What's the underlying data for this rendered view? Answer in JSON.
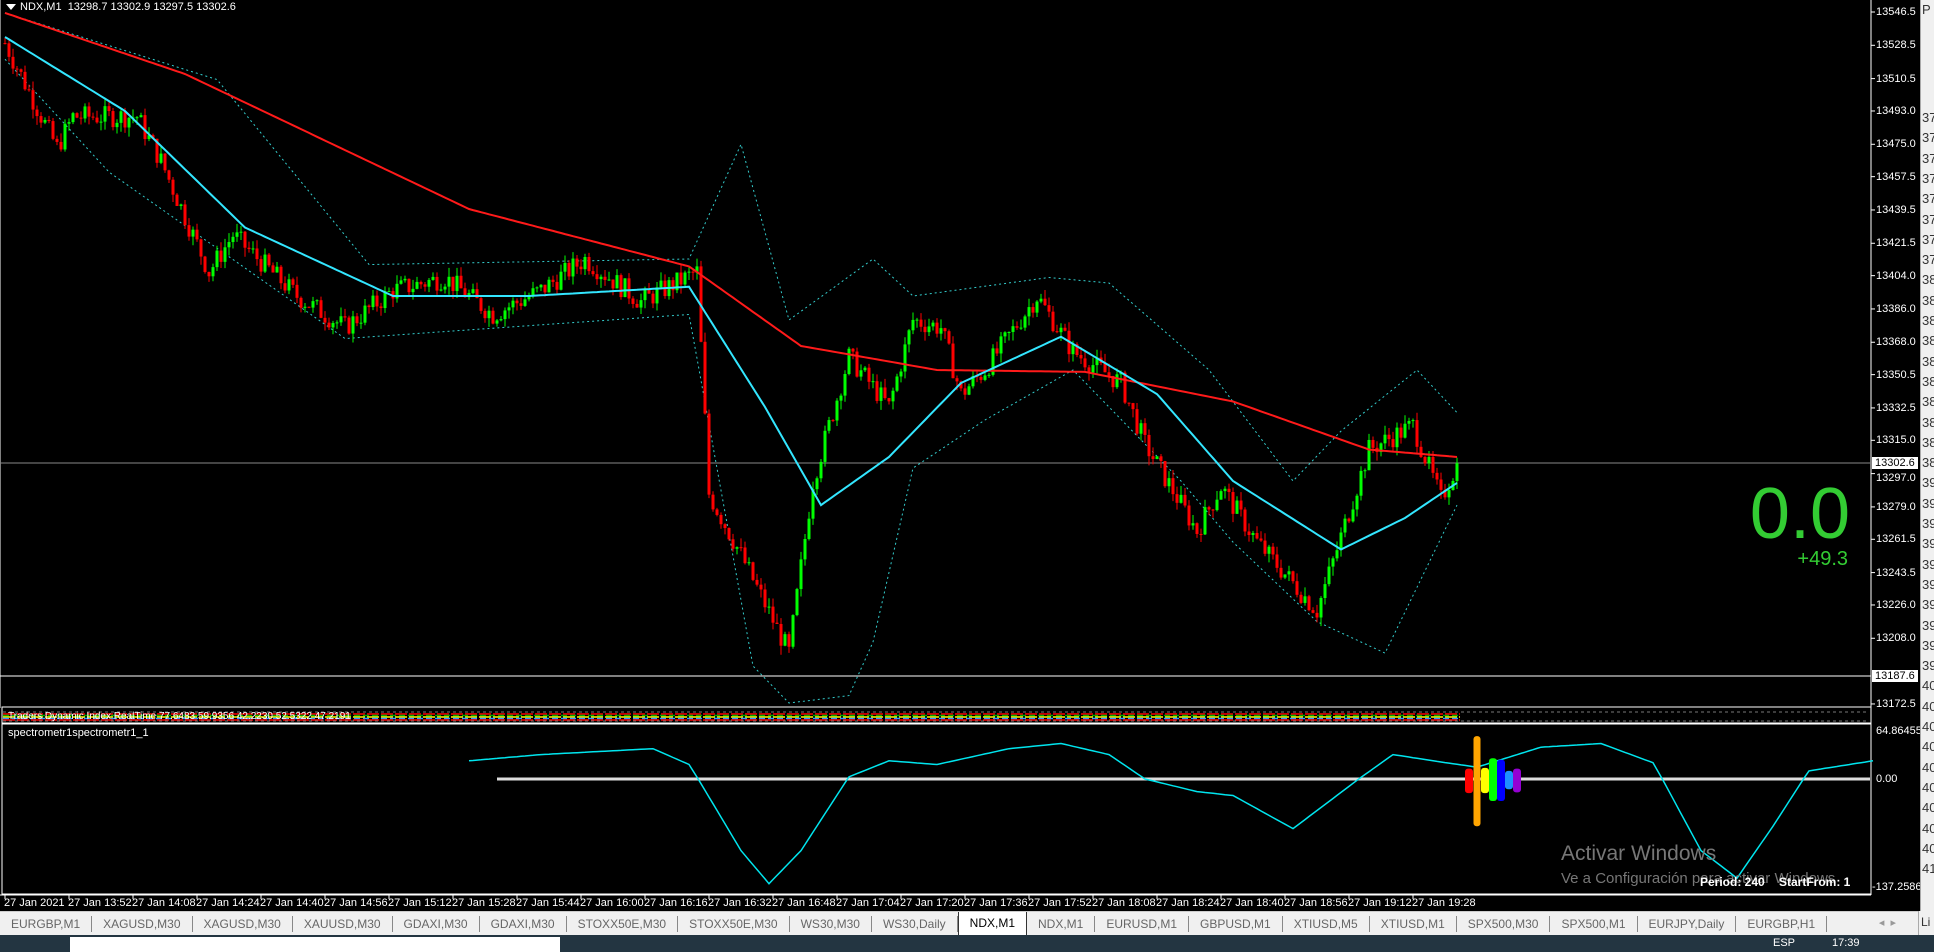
{
  "header": {
    "symbol": "NDX,M1",
    "ohlc": "13298.7 13302.9 13297.5 13302.6"
  },
  "price_axis": {
    "labels": [
      "13546.5",
      "13528.5",
      "13510.5",
      "13493.0",
      "13475.0",
      "13457.5",
      "13439.5",
      "13421.5",
      "13404.0",
      "13386.0",
      "13368.0",
      "13350.5",
      "13332.5",
      "13315.0",
      "13297.0",
      "13279.0",
      "13261.5",
      "13243.5",
      "13226.0",
      "13208.0",
      "13172.5"
    ],
    "current": "13302.6",
    "line2": "13187.6"
  },
  "time_axis": {
    "labels": [
      "27 Jan 2021",
      "27 Jan 13:52",
      "27 Jan 14:08",
      "27 Jan 14:24",
      "27 Jan 14:40",
      "27 Jan 14:56",
      "27 Jan 15:12",
      "27 Jan 15:28",
      "27 Jan 15:44",
      "27 Jan 16:00",
      "27 Jan 16:16",
      "27 Jan 16:32",
      "27 Jan 16:48",
      "27 Jan 17:04",
      "27 Jan 17:20",
      "27 Jan 17:36",
      "27 Jan 17:52",
      "27 Jan 18:08",
      "27 Jan 18:24",
      "27 Jan 18:40",
      "27 Jan 18:56",
      "27 Jan 19:12",
      "27 Jan 19:28"
    ]
  },
  "tdi": {
    "label": "Traders Dynamic Index RealTime 77.6483 59.9356 42.2230 52.5322 47.2191"
  },
  "spectrometer": {
    "label": "spectrometr1spectrometr1_1",
    "max": "64.86455",
    "zero": "0.00",
    "min": "-137.2586",
    "period": "Period: 240",
    "start_from": "StartFrom: 1"
  },
  "display": {
    "big": "0.0",
    "change": "+49.3"
  },
  "watermark": {
    "title": "Activar Windows",
    "sub": "Ve a Configuración para activar Windows"
  },
  "tabs": [
    "EURGBP,M1",
    "XAGUSD,M30",
    "XAGUSD,M30",
    "XAUUSD,M30",
    "GDAXI,M30",
    "GDAXI,M30",
    "STOXX50E,M30",
    "STOXX50E,M30",
    "WS30,M30",
    "WS30,Daily",
    "NDX,M1",
    "NDX,M1",
    "EURUSD,M1",
    "GBPUSD,M1",
    "XTIUSD,M5",
    "XTIUSD,M1",
    "SPX500,M30",
    "SPX500,M1",
    "EURJPY,Daily",
    "EURGBP,H1"
  ],
  "active_tab": 10,
  "tab_extra": "Li",
  "taskbar": {
    "lang": "ESP",
    "time": "17:39"
  },
  "right_panel": {
    "top": "P",
    "rows": [
      "37",
      "37",
      "37",
      "37",
      "37",
      "37",
      "37",
      "37",
      "38",
      "38",
      "38",
      "38",
      "38",
      "38",
      "38",
      "38",
      "38",
      "38",
      "39",
      "39",
      "39",
      "39",
      "39",
      "39",
      "39",
      "39",
      "39",
      "39",
      "40",
      "40",
      "40",
      "40",
      "40",
      "40",
      "40",
      "40",
      "40",
      "41"
    ]
  },
  "colors": {
    "bull": "#00ff00",
    "bear": "#ff0000",
    "ma_slow": "#ff1a1a",
    "ma_fast": "#33e6ff",
    "bands": "#33cccc",
    "big": "#33cc33"
  },
  "chart_data": {
    "type": "candlestick",
    "x_unit": "minutes since 13:36",
    "close_path": [
      [
        0,
        13529.7
      ],
      [
        13,
        13473
      ],
      [
        17,
        13490
      ],
      [
        33,
        13490
      ],
      [
        39,
        13466
      ],
      [
        51,
        13406
      ],
      [
        57,
        13426
      ],
      [
        73,
        13393
      ],
      [
        85,
        13376
      ],
      [
        97,
        13396
      ],
      [
        110,
        13403
      ],
      [
        122,
        13383
      ],
      [
        134,
        13396
      ],
      [
        145,
        13413
      ],
      [
        159,
        13390
      ],
      [
        173,
        13406
      ],
      [
        176,
        13286
      ],
      [
        184,
        13253
      ],
      [
        196,
        13200
      ],
      [
        202,
        13293
      ],
      [
        211,
        13360
      ],
      [
        221,
        13333
      ],
      [
        227,
        13380
      ],
      [
        234,
        13376
      ],
      [
        239,
        13340
      ],
      [
        245,
        13353
      ],
      [
        258,
        13393
      ],
      [
        267,
        13363
      ],
      [
        279,
        13346
      ],
      [
        285,
        13313
      ],
      [
        298,
        13266
      ],
      [
        304,
        13290
      ],
      [
        313,
        13260
      ],
      [
        328,
        13223
      ],
      [
        333,
        13256
      ],
      [
        341,
        13310
      ],
      [
        352,
        13323
      ],
      [
        359,
        13283
      ],
      [
        363,
        13302.6
      ]
    ],
    "ma_slow": [
      [
        0,
        13546
      ],
      [
        45,
        13513
      ],
      [
        116,
        13440
      ],
      [
        171,
        13409
      ],
      [
        199,
        13366
      ],
      [
        233,
        13353
      ],
      [
        270,
        13352
      ],
      [
        307,
        13336
      ],
      [
        341,
        13310
      ],
      [
        363,
        13306
      ]
    ],
    "ma_fast": [
      [
        0,
        13533
      ],
      [
        30,
        13493
      ],
      [
        60,
        13430
      ],
      [
        97,
        13393
      ],
      [
        131,
        13393
      ],
      [
        171,
        13398
      ],
      [
        190,
        13333
      ],
      [
        204,
        13280
      ],
      [
        221,
        13306
      ],
      [
        239,
        13346
      ],
      [
        264,
        13371
      ],
      [
        288,
        13340
      ],
      [
        307,
        13293
      ],
      [
        334,
        13256
      ],
      [
        350,
        13273
      ],
      [
        363,
        13292
      ]
    ],
    "band_upper": [
      [
        0,
        13546
      ],
      [
        53,
        13510
      ],
      [
        91,
        13410
      ],
      [
        171,
        13413
      ],
      [
        184,
        13475
      ],
      [
        196,
        13380
      ],
      [
        217,
        13413
      ],
      [
        227,
        13393
      ],
      [
        261,
        13403
      ],
      [
        276,
        13400
      ],
      [
        301,
        13353
      ],
      [
        322,
        13293
      ],
      [
        334,
        13320
      ],
      [
        353,
        13353
      ],
      [
        363,
        13330
      ]
    ],
    "band_lower": [
      [
        0,
        13521
      ],
      [
        26,
        13460
      ],
      [
        85,
        13370
      ],
      [
        171,
        13383
      ],
      [
        187,
        13193
      ],
      [
        196,
        13173
      ],
      [
        211,
        13177
      ],
      [
        217,
        13206
      ],
      [
        227,
        13300
      ],
      [
        245,
        13326
      ],
      [
        267,
        13353
      ],
      [
        294,
        13293
      ],
      [
        307,
        13260
      ],
      [
        328,
        13217
      ],
      [
        345,
        13200
      ],
      [
        363,
        13280
      ]
    ],
    "spectro": [
      [
        116,
        24.6
      ],
      [
        134,
        33
      ],
      [
        162,
        41
      ],
      [
        171,
        19.6
      ],
      [
        184,
        -91
      ],
      [
        191,
        -133
      ],
      [
        199,
        -91
      ],
      [
        211,
        3
      ],
      [
        221,
        24.6
      ],
      [
        233,
        19.6
      ],
      [
        251,
        41
      ],
      [
        264,
        48
      ],
      [
        276,
        33
      ],
      [
        285,
        0
      ],
      [
        298,
        -16
      ],
      [
        307,
        -21
      ],
      [
        322,
        -63
      ],
      [
        331,
        -28.6
      ],
      [
        347,
        33
      ],
      [
        359,
        23
      ],
      [
        368,
        16
      ],
      [
        384,
        43
      ],
      [
        399,
        48
      ],
      [
        412,
        22
      ],
      [
        424,
        -91
      ],
      [
        433,
        -126
      ],
      [
        442,
        -60
      ],
      [
        451,
        11
      ],
      [
        467,
        24.6
      ]
    ],
    "spectrum_bars": [
      {
        "color": "#ff0000",
        "hi": 14,
        "lo": -18
      },
      {
        "color": "#ffa500",
        "hi": 58,
        "lo": -60
      },
      {
        "color": "#ffff00",
        "hi": 15,
        "lo": -18
      },
      {
        "color": "#00ff00",
        "hi": 28,
        "lo": -28
      },
      {
        "color": "#0000ff",
        "hi": 26,
        "lo": -28
      },
      {
        "color": "#1e90ff",
        "hi": 11,
        "lo": -13
      },
      {
        "color": "#9400d3",
        "hi": 14,
        "lo": -17
      }
    ]
  }
}
